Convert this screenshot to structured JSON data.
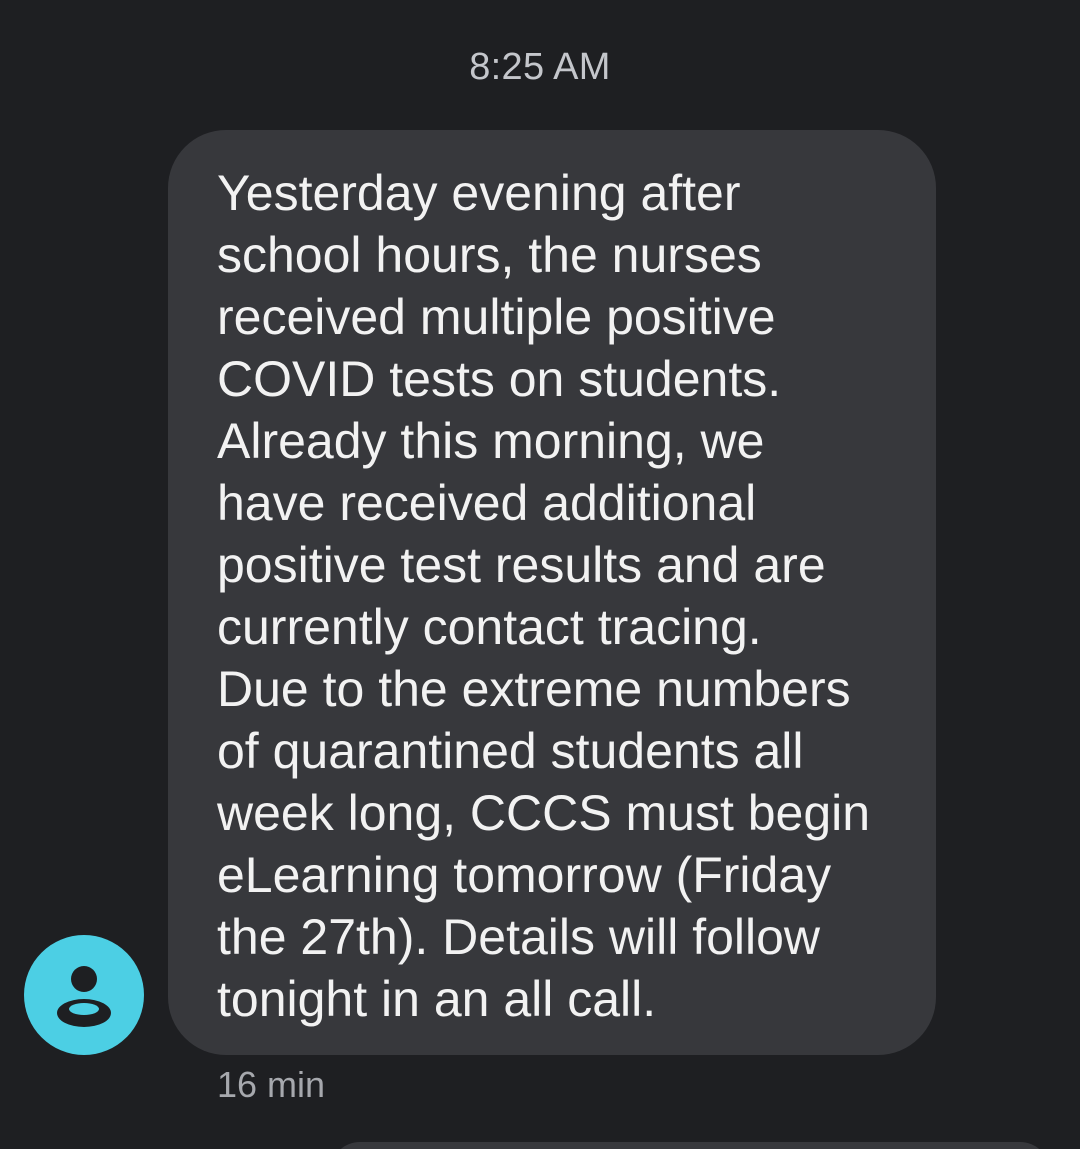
{
  "conversation": {
    "timestamp": "8:25 AM",
    "message": {
      "lines": [
        "Yesterday evening after",
        "school hours, the nurses",
        "received multiple positive",
        "COVID tests on students.",
        "Already this morning, we",
        "have received additional",
        "positive test results and are",
        "currently contact tracing.",
        "Due to the extreme numbers",
        "of quarantined students all",
        "week long, CCCS must begin",
        "eLearning tomorrow (Friday",
        "the 27th). Details will follow",
        "tonight in an all call."
      ],
      "age": "16 min"
    },
    "avatar": {
      "icon": "person-icon",
      "color": "#4ccfe4"
    }
  }
}
